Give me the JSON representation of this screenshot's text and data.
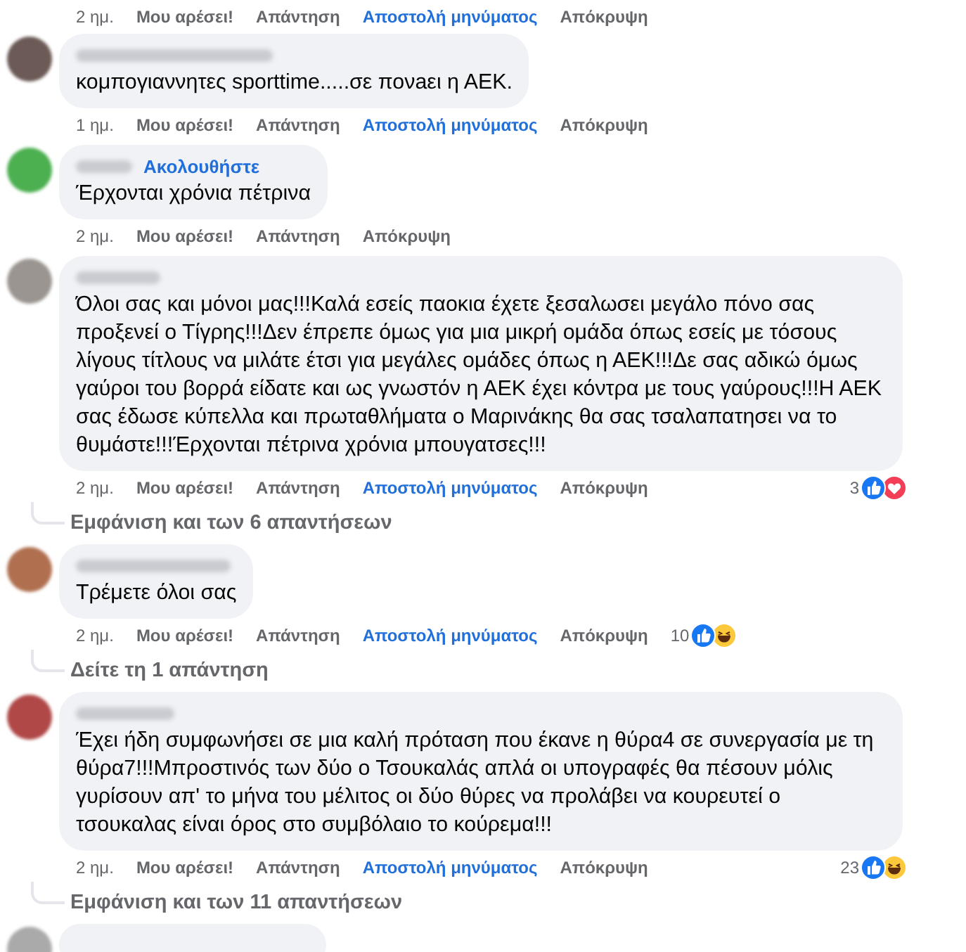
{
  "top_actions": {
    "time": "2 ημ.",
    "actions": [
      {
        "kind": "like",
        "label": "Μου αρέσει!"
      },
      {
        "kind": "reply",
        "label": "Απάντηση"
      },
      {
        "kind": "message",
        "label": "Αποστολή μηνύματος"
      },
      {
        "kind": "hide",
        "label": "Απόκρυψη"
      }
    ]
  },
  "comments": [
    {
      "text": "κομπογιαννητες sporttime.....σε πονaει η ΑΕΚ.",
      "time": "1 ημ.",
      "actions": [
        {
          "kind": "like",
          "label": "Μου αρέσει!"
        },
        {
          "kind": "reply",
          "label": "Απάντηση"
        },
        {
          "kind": "message",
          "label": "Αποστολή μηνύματος"
        },
        {
          "kind": "hide",
          "label": "Απόκρυψη"
        }
      ]
    },
    {
      "follow": "Ακολουθήστε",
      "text": "Έρχονται χρόνια πέτρινα",
      "time": "2 ημ.",
      "actions": [
        {
          "kind": "like",
          "label": "Μου αρέσει!"
        },
        {
          "kind": "reply",
          "label": "Απάντηση"
        },
        {
          "kind": "hide",
          "label": "Απόκρυψη"
        }
      ]
    },
    {
      "text": "Όλοι σας και μόνοι μας!!!Καλά εσείς παοκια έχετε ξεσαλωσει μεγάλο πόνο σας προξενεί ο Τίγρης!!!Δεν έπρεπε όμως για μια μικρή ομάδα όπως εσείς με τόσους λίγους τίτλους να μιλάτε έτσι για μεγάλες ομάδες όπως η ΑΕΚ!!!Δε σας αδικώ όμως γαύροι του βορρά είδατε και ως γνωστόν η ΑΕΚ έχει κόντρα με τους γαύρους!!!Η ΑΕΚ σας έδωσε κύπελλα και πρωταθλήματα ο Μαρινάκης θα σας τσαλαπατησει να το θυμάστε!!!Έρχονται πέτρινα χρόνια μπουγατσες!!!",
      "time": "2 ημ.",
      "actions": [
        {
          "kind": "like",
          "label": "Μου αρέσει!"
        },
        {
          "kind": "reply",
          "label": "Απάντηση"
        },
        {
          "kind": "message",
          "label": "Αποστολή μηνύματος"
        },
        {
          "kind": "hide",
          "label": "Απόκρυψη"
        }
      ],
      "reaction_count": "3",
      "reactions": [
        {
          "kind": "like"
        },
        {
          "kind": "love"
        }
      ],
      "replies_link": "Εμφάνιση και των 6 απαντήσεων"
    },
    {
      "text": "Τρέμετε όλοι σας",
      "time": "2 ημ.",
      "actions": [
        {
          "kind": "like",
          "label": "Μου αρέσει!"
        },
        {
          "kind": "reply",
          "label": "Απάντηση"
        },
        {
          "kind": "message",
          "label": "Αποστολή μηνύματος"
        },
        {
          "kind": "hide",
          "label": "Απόκρυψη"
        }
      ],
      "reaction_count": "10",
      "reactions": [
        {
          "kind": "like"
        },
        {
          "kind": "haha"
        }
      ],
      "replies_link": "Δείτε τη 1 απάντηση"
    },
    {
      "text": "Έχει ήδη συμφωνήσει σε μια καλή πρόταση που έκανε η θύρα4 σε συνεργασία με τη θύρα7!!!Μπροστινός των δύο ο Τσουκαλάς απλά οι υπογραφές θα πέσουν μόλις γυρίσουν απ' το μήνα του μέλιτος οι δύο θύρες να προλάβει να κουρευτεί ο τσουκαλας είναι όρος στο συμβόλαιο το κούρεμα!!!",
      "time": "2 ημ.",
      "actions": [
        {
          "kind": "like",
          "label": "Μου αρέσει!"
        },
        {
          "kind": "reply",
          "label": "Απάντηση"
        },
        {
          "kind": "message",
          "label": "Αποστολή μηνύματος"
        },
        {
          "kind": "hide",
          "label": "Απόκρυψη"
        }
      ],
      "reaction_count": "23",
      "reactions": [
        {
          "kind": "like"
        },
        {
          "kind": "haha"
        }
      ],
      "replies_link": "Εμφάνιση και των 11 απαντήσεων"
    }
  ]
}
